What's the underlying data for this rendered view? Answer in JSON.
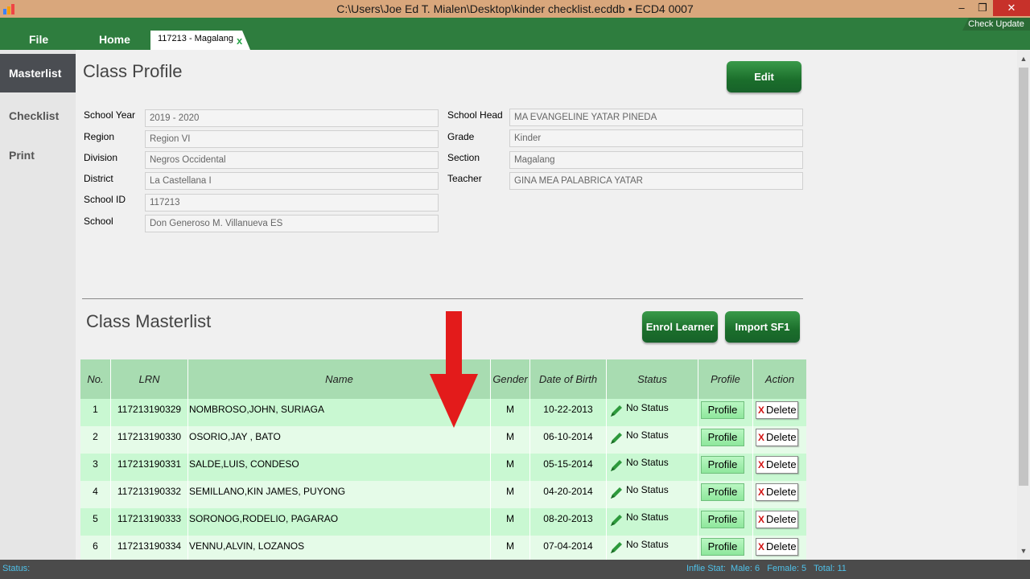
{
  "window": {
    "title": "C:\\Users\\Joe Ed T. Mialen\\Desktop\\kinder checklist.ecddb   •   ECD4 0007",
    "minimize_glyph": "–",
    "restore_glyph": "❐",
    "close_glyph": "✕"
  },
  "menu": {
    "file": "File",
    "home": "Home",
    "tab_label": "117213  -   Magalang",
    "tab_close": "x",
    "check_update": "Check Update"
  },
  "nav": {
    "masterlist": "Masterlist",
    "checklist": "Checklist",
    "print": "Print"
  },
  "profile": {
    "title": "Class Profile",
    "edit_label": "Edit",
    "fields_left": [
      {
        "label": "School Year",
        "value": "2019 - 2020"
      },
      {
        "label": "Region",
        "value": "Region VI"
      },
      {
        "label": "Division",
        "value": "Negros Occidental"
      },
      {
        "label": "District",
        "value": "La Castellana I"
      },
      {
        "label": "School ID",
        "value": "117213"
      },
      {
        "label": "School",
        "value": "Don Generoso M. Villanueva ES"
      }
    ],
    "fields_right": [
      {
        "label": "School Head",
        "value": "MA EVANGELINE YATAR PINEDA"
      },
      {
        "label": "Grade",
        "value": "Kinder"
      },
      {
        "label": "Section",
        "value": "Magalang"
      },
      {
        "label": "Teacher",
        "value": "GINA MEA PALABRICA YATAR"
      }
    ]
  },
  "masterlist": {
    "title": "Class Masterlist",
    "enrol_label": "Enrol Learner",
    "import_label": "Import SF1",
    "columns": [
      "No.",
      "LRN",
      "Name",
      "Gender",
      "Date of Birth",
      "Status",
      "Profile",
      "Action"
    ],
    "rows": [
      {
        "no": "1",
        "lrn": "117213190329",
        "name": "NOMBROSO,JOHN, SURIAGA",
        "gender": "M",
        "dob": "10-22-2013",
        "status": "No Status",
        "profile": "Profile",
        "action": "Delete"
      },
      {
        "no": "2",
        "lrn": "117213190330",
        "name": "OSORIO,JAY , BATO",
        "gender": "M",
        "dob": "06-10-2014",
        "status": "No Status",
        "profile": "Profile",
        "action": "Delete"
      },
      {
        "no": "3",
        "lrn": "117213190331",
        "name": "SALDE,LUIS, CONDESO",
        "gender": "M",
        "dob": "05-15-2014",
        "status": "No Status",
        "profile": "Profile",
        "action": "Delete"
      },
      {
        "no": "4",
        "lrn": "117213190332",
        "name": "SEMILLANO,KIN JAMES, PUYONG",
        "gender": "M",
        "dob": "04-20-2014",
        "status": "No Status",
        "profile": "Profile",
        "action": "Delete"
      },
      {
        "no": "5",
        "lrn": "117213190333",
        "name": "SORONOG,RODELIO, PAGARAO",
        "gender": "M",
        "dob": "08-20-2013",
        "status": "No Status",
        "profile": "Profile",
        "action": "Delete"
      },
      {
        "no": "6",
        "lrn": "117213190334",
        "name": "VENNU,ALVIN, LOZANOS",
        "gender": "M",
        "dob": "07-04-2014",
        "status": "No Status",
        "profile": "Profile",
        "action": "Delete"
      }
    ],
    "delete_glyph": "X",
    "row_colors": [
      "#c9f8d2",
      "#e5fbe8"
    ]
  },
  "statusbar": {
    "label": "Status:",
    "stats": "Inflie Stat:  Male: 6   Female: 5   Total: 11"
  },
  "colors": {
    "menubar": "#2e7d3e",
    "titlebar": "#d9a77c",
    "table_header": "#a8dcb1",
    "arrow": "#e31b1b"
  },
  "icons": {
    "app": "app-icon",
    "status": "pencil-icon",
    "delete": "red-x-icon",
    "annotation": "red-down-arrow"
  }
}
